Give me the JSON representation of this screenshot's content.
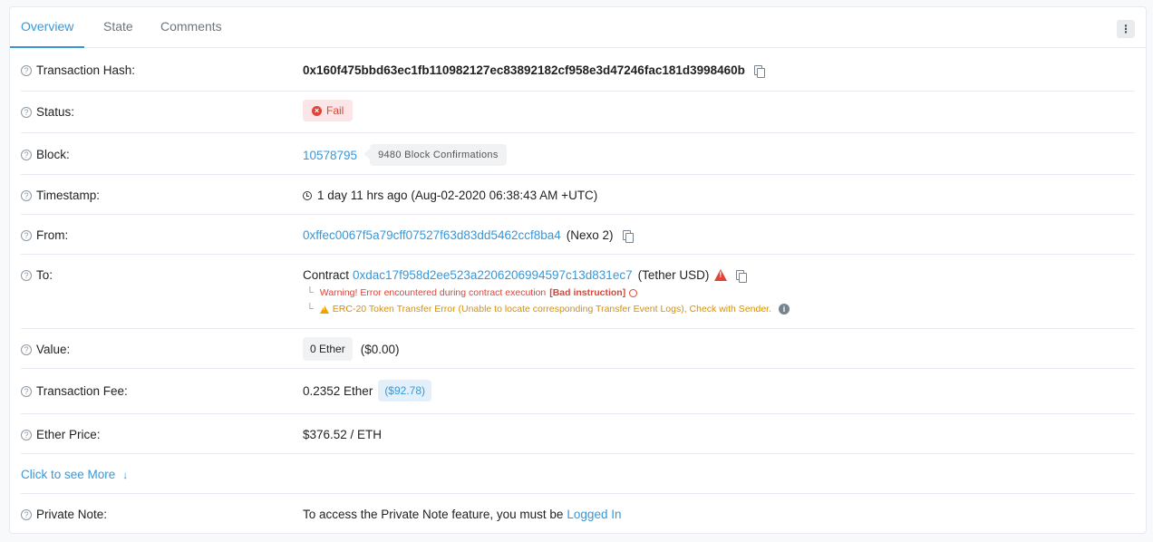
{
  "tabs": [
    {
      "label": "Overview",
      "active": true
    },
    {
      "label": "State",
      "active": false
    },
    {
      "label": "Comments",
      "active": false
    }
  ],
  "menu": {
    "icon": "vertical-dots-icon",
    "glyph": "⋮"
  },
  "help_glyph": "?",
  "rows": {
    "tx_hash": {
      "label": "Transaction Hash:",
      "value": "0x160f475bbd63ec1fb110982127ec83892182cf958e3d47246fac181d3998460b"
    },
    "status": {
      "label": "Status:",
      "value": "Fail"
    },
    "block": {
      "label": "Block:",
      "number": "10578795",
      "confirmations": "9480 Block Confirmations"
    },
    "timestamp": {
      "label": "Timestamp:",
      "value": "1 day 11 hrs ago (Aug-02-2020 06:38:43 AM +UTC)"
    },
    "from": {
      "label": "From:",
      "address": "0xffec0067f5a79cff07527f63d83dd5462ccf8ba4",
      "tag": "(Nexo 2)"
    },
    "to": {
      "label": "To:",
      "prefix": "Contract",
      "address": "0xdac17f958d2ee523a2206206994597c13d831ec7",
      "tag": "(Tether USD)",
      "warning_text": "Warning! Error encountered during contract execution",
      "warning_bold": "[Bad instruction]",
      "erc20_text": "ERC-20 Token Transfer Error (Unable to locate corresponding Transfer Event Logs), Check with Sender.",
      "sub_arrow": "└"
    },
    "value": {
      "label": "Value:",
      "ether": "0 Ether",
      "usd": "($0.00)"
    },
    "fee": {
      "label": "Transaction Fee:",
      "ether": "0.2352 Ether",
      "usd": "($92.78)"
    },
    "price": {
      "label": "Ether Price:",
      "value": "$376.52 / ETH"
    },
    "see_more": {
      "label": "Click to see More",
      "arrow": "↓"
    },
    "note": {
      "label": "Private Note:",
      "text": "To access the Private Note feature, you must be",
      "link": "Logged In"
    }
  },
  "colors": {
    "accent": "#3498db",
    "danger": "#de4437",
    "warning": "#f0a000"
  }
}
